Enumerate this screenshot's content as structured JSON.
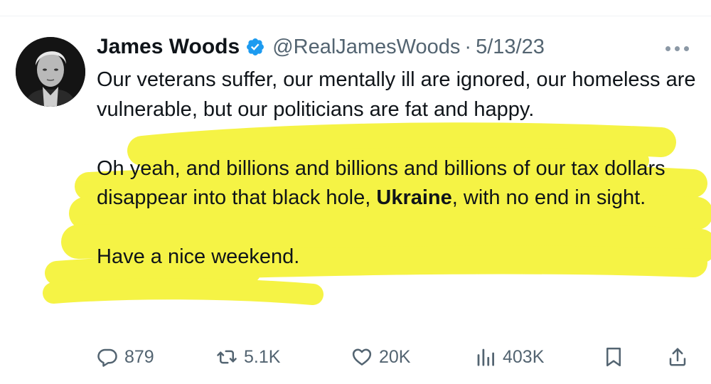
{
  "tweet": {
    "author": {
      "display_name": "James Woods",
      "handle": "@RealJamesWoods",
      "verified_icon": "verified-badge-icon",
      "avatar": "profile-photo"
    },
    "separator": "·",
    "date": "5/13/23",
    "body": {
      "paragraph_1": "Our veterans suffer, our mentally ill are ignored, our homeless are vulnerable, but our politicians are fat and happy.",
      "paragraph_2_before": "Oh yeah, and billions and billions and billions of our tax dollars disappear into that black hole, ",
      "paragraph_2_bold": "Ukraine",
      "paragraph_2_after": ", with no end in sight.",
      "paragraph_3": "Have a nice weekend."
    },
    "stats": {
      "replies": "879",
      "retweets": "5.1K",
      "likes": "20K",
      "views": "403K"
    }
  },
  "colors": {
    "text": "#0f1419",
    "secondary": "#536471",
    "verified": "#1d9bf0",
    "highlighter": "#f5f231"
  },
  "icons": [
    "more-icon",
    "reply-icon",
    "retweet-icon",
    "like-icon",
    "views-icon",
    "bookmark-icon",
    "share-icon"
  ]
}
